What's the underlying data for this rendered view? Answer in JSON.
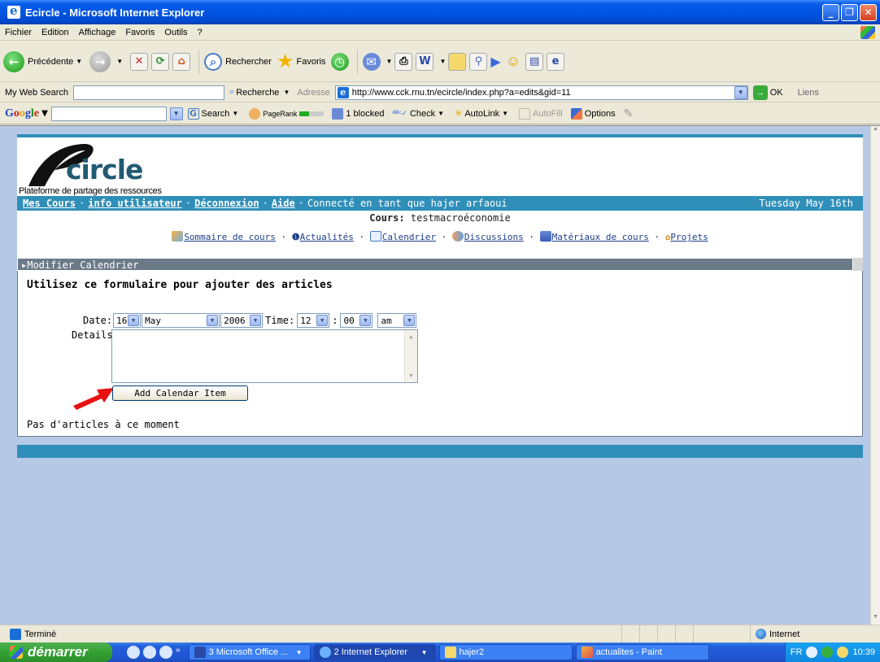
{
  "window": {
    "title": "Ecircle - Microsoft Internet Explorer"
  },
  "menu": [
    "Fichier",
    "Edition",
    "Affichage",
    "Favoris",
    "Outils",
    "?"
  ],
  "toolbar": {
    "back": "Précédente",
    "search": "Rechercher",
    "favorites": "Favoris"
  },
  "search_bar": {
    "label": "My Web Search",
    "recherche": "Recherche",
    "adresse_label": "Adresse",
    "url": "http://www.cck.rnu.tn/ecircle/index.php?a=edits&gid=11",
    "ok": "OK",
    "liens": "Liens"
  },
  "google_bar": {
    "search": "Search",
    "pagerank": "PageRank",
    "blocked": "1 blocked",
    "check": "Check",
    "autolink": "AutoLink",
    "autofill": "AutoFill",
    "options": "Options"
  },
  "site": {
    "logo_word": "circle",
    "logo_tagline": "Plateforme de partage des ressources",
    "nav": {
      "mes_cours": "Mes Cours",
      "info": "info utilisateur",
      "deconnexion": "Déconnexion",
      "aide": "Aide",
      "connected": "Connecté en tant que hajer arfaoui",
      "date": "Tuesday May 16th"
    },
    "course": {
      "label": "Cours:",
      "value": "testmacroéconomie"
    },
    "links": {
      "sommaire": "Sommaire de cours",
      "actualites": "Actualités",
      "calendrier": "Calendrier",
      "discussions": "Discussions",
      "materiaux": "Matériaux de cours",
      "projets": "Projets"
    },
    "section_title": "▸Modifier Calendrier",
    "form": {
      "heading": "Utilisez ce formulaire pour ajouter des articles",
      "date_label": "Date:",
      "day": "16",
      "month": "May",
      "year": "2006",
      "time_label": "Time:",
      "hour": "12",
      "colon": ":",
      "minute": "00",
      "ampm": "am",
      "details_label": "Details:",
      "submit": "Add Calendar Item"
    },
    "no_items": "Pas d'articles à ce moment"
  },
  "statusbar": {
    "text": "Terminé",
    "zone": "Internet"
  },
  "taskbar": {
    "start": "démarrer",
    "tasks": [
      "3 Microsoft Office ...",
      "2 Internet Explorer",
      "hajer2",
      "actualites - Paint"
    ],
    "lang": "FR",
    "clock": "10:39"
  }
}
